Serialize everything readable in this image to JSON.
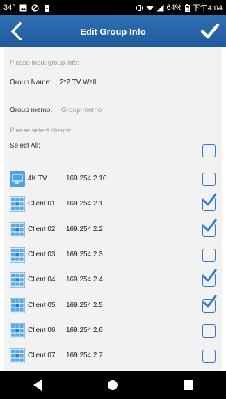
{
  "status_bar": {
    "temperature": "34°",
    "battery": "64%",
    "time": "下午4:04"
  },
  "header": {
    "title": "Edit Group Info"
  },
  "form": {
    "input_hint": "Please input group info:",
    "group_name_label": "Group Name:",
    "group_name_value": "2*2 TV Wall",
    "group_memo_label": "Group memo:",
    "group_memo_placeholder": "Group memo",
    "select_hint": "Please select clients:",
    "select_all_label": "Select All:"
  },
  "clients": [
    {
      "name": "4K TV",
      "ip": "169.254.2.10",
      "checked": false,
      "icon": "tv-icon"
    },
    {
      "name": "Client 01",
      "ip": "169.254.2.1",
      "checked": true,
      "icon": "video-wall-icon"
    },
    {
      "name": "Client 02",
      "ip": "169.254.2.2",
      "checked": true,
      "icon": "video-wall-icon"
    },
    {
      "name": "Client 03",
      "ip": "169.254.2.3",
      "checked": false,
      "icon": "video-wall-icon"
    },
    {
      "name": "Client 04",
      "ip": "169.254.2.4",
      "checked": true,
      "icon": "video-wall-icon"
    },
    {
      "name": "Client 05",
      "ip": "169.254.2.5",
      "checked": true,
      "icon": "video-wall-icon"
    },
    {
      "name": "Client 06",
      "ip": "169.254.2.6",
      "checked": false,
      "icon": "video-wall-icon"
    },
    {
      "name": "Client 07",
      "ip": "169.254.2.7",
      "checked": false,
      "icon": "video-wall-icon"
    }
  ],
  "colors": {
    "header": "#2f6fb4",
    "accent": "#2f79c8",
    "background": "#f2f2f2"
  }
}
